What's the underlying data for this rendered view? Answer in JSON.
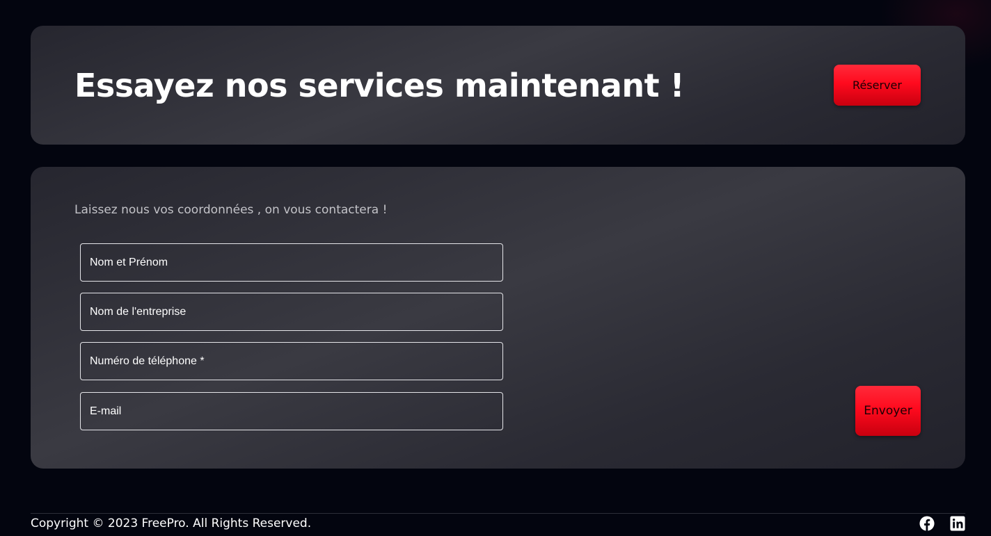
{
  "cta": {
    "title": "Essayez nos services maintenant !",
    "reserve_label": "Réserver"
  },
  "contact_form": {
    "intro": "Laissez nous vos coordonnées , on vous contactera !",
    "fields": [
      {
        "placeholder": "Nom et Prénom",
        "value": ""
      },
      {
        "placeholder": "Nom de l'entreprise",
        "value": ""
      },
      {
        "placeholder": "Numéro de téléphone *",
        "value": ""
      },
      {
        "placeholder": "E-mail",
        "value": ""
      }
    ],
    "submit_label": "Envoyer"
  },
  "footer": {
    "copyright": "Copyright © 2023 FreePro. All Rights Reserved.",
    "social": [
      {
        "icon": "facebook-icon"
      },
      {
        "icon": "linkedin-icon"
      }
    ]
  },
  "colors": {
    "background": "#03050f",
    "card": "#34343c",
    "accent": "#ff0a1e",
    "field_border": "#e6e6ea",
    "intro_text": "#c3c3c8"
  }
}
